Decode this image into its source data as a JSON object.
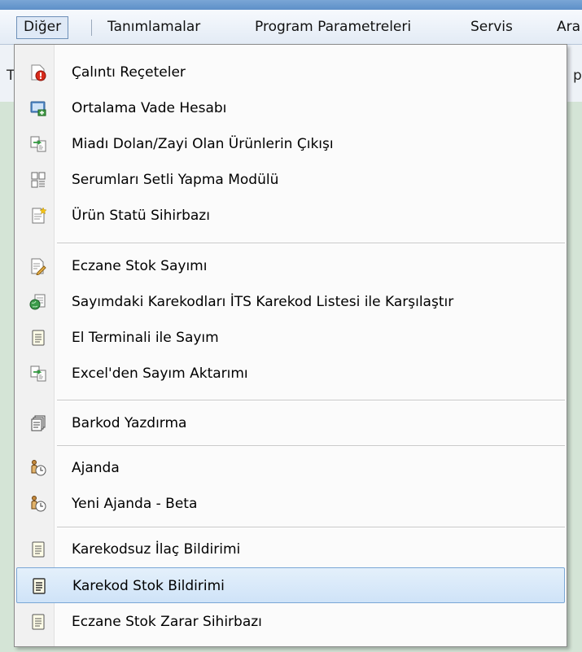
{
  "menubar": {
    "items": [
      {
        "label": "Diğer"
      },
      {
        "label": "Tanımlamalar"
      },
      {
        "label": "Program Parametreleri"
      },
      {
        "label": "Servis"
      },
      {
        "label": "Ara"
      }
    ]
  },
  "toolbar": {
    "left_fragment": "T",
    "right_fragment": "p"
  },
  "dropdown": {
    "items": [
      {
        "label": "Çalıntı Reçeteler",
        "icon": "stolen-prescription-icon"
      },
      {
        "label": "Ortalama Vade Hesabı",
        "icon": "average-term-icon"
      },
      {
        "label": "Miadı Dolan/Zayi Olan Ürünlerin Çıkışı",
        "icon": "document-transfer-icon"
      },
      {
        "label": "Serumları Setli Yapma Modülü",
        "icon": "serum-set-icon"
      },
      {
        "label": "Ürün Statü Sihirbazı",
        "icon": "wizard-document-icon"
      },
      {
        "label": "Eczane Stok Sayımı",
        "icon": "edit-document-icon"
      },
      {
        "label": "Sayımdaki Karekodları İTS Karekod Listesi ile Karşılaştır",
        "icon": "compare-globe-icon"
      },
      {
        "label": "El Terminali ile Sayım",
        "icon": "document-icon"
      },
      {
        "label": "Excel'den Sayım Aktarımı",
        "icon": "document-transfer-icon"
      },
      {
        "label": "Barkod Yazdırma",
        "icon": "barcode-print-icon"
      },
      {
        "label": "Ajanda",
        "icon": "agenda-clock-icon"
      },
      {
        "label": "Yeni Ajanda - Beta",
        "icon": "agenda-clock-icon"
      },
      {
        "label": "Karekodsuz İlaç Bildirimi",
        "icon": "document-icon"
      },
      {
        "label": "Karekod Stok Bildirimi",
        "icon": "document-icon",
        "highlighted": true
      },
      {
        "label": "Eczane Stok Zarar Sihirbazı",
        "icon": "document-icon"
      }
    ]
  },
  "colors": {
    "highlight_bg": "#cfe3f8",
    "highlight_border": "#7aa7d6",
    "menu_bg": "#fbfbfb"
  }
}
